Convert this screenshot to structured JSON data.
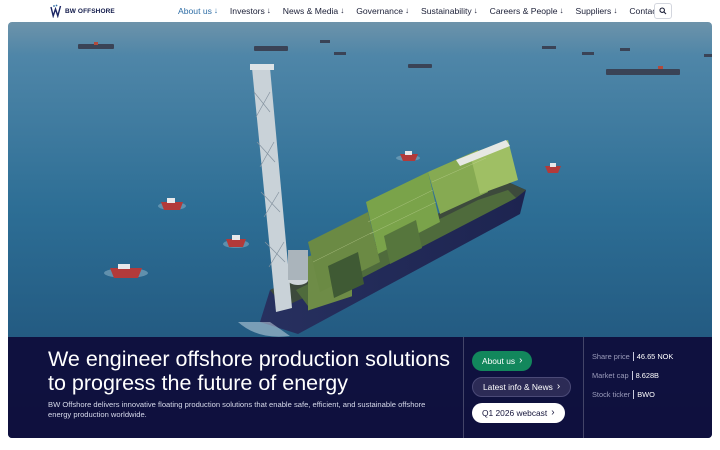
{
  "header": {
    "logo_text": "BW OFFSHORE",
    "nav": [
      {
        "label": "About us",
        "has_arrow": true
      },
      {
        "label": "Investors",
        "has_arrow": true
      },
      {
        "label": "News & Media",
        "has_arrow": true
      },
      {
        "label": "Governance",
        "has_arrow": true
      },
      {
        "label": "Sustainability",
        "has_arrow": true
      },
      {
        "label": "Careers & People",
        "has_arrow": true
      },
      {
        "label": "Suppliers",
        "has_arrow": true
      },
      {
        "label": "Contact",
        "has_arrow": false
      }
    ],
    "arrow_glyph": "↓",
    "search_icon": "search-icon"
  },
  "hero": {
    "headline": "We engineer offshore production solutions to progress the future of energy",
    "subtext": "BW Offshore delivers innovative floating production solutions that enable safe, efficient, and sustainable offshore energy production worldwide.",
    "buttons": [
      {
        "label": "About us",
        "icon": "chevron-right-icon"
      },
      {
        "label": "Latest info & News",
        "icon": "chevron-right-icon"
      },
      {
        "label": "Q1 2026 webcast",
        "icon": "chevron-right-icon"
      }
    ],
    "chevron_glyph": "›",
    "stock": {
      "share_price_label": "Share price",
      "share_price_value": "46.65 NOK",
      "market_cap_label": "Market cap",
      "market_cap_value": "8.628B",
      "ticker_label": "Stock ticker",
      "ticker_value": "BWO"
    }
  },
  "colors": {
    "nav_active": "#2f6ea6",
    "overlay": "#0e0c3a",
    "primary_button": "#12875c",
    "sea": "#2d6e95"
  }
}
